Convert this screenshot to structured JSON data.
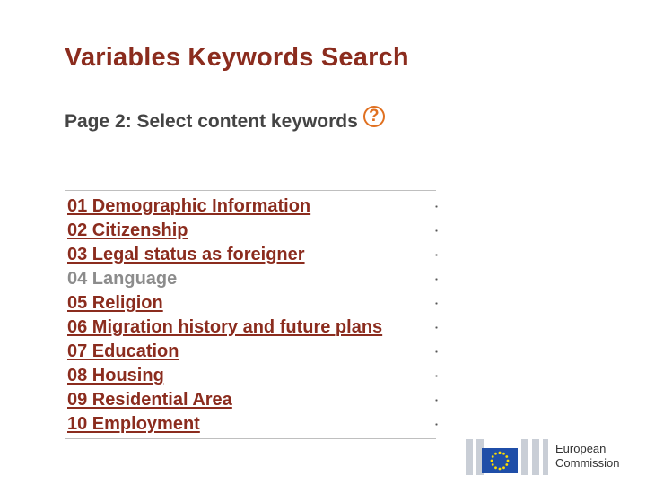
{
  "header": {
    "title": "Variables Keywords Search",
    "subtitle": "Page 2: Select content keywords",
    "help_icon": "help-icon"
  },
  "keywords": [
    {
      "label": "01 Demographic Information",
      "enabled": true
    },
    {
      "label": "02 Citizenship",
      "enabled": true
    },
    {
      "label": "03 Legal status as foreigner",
      "enabled": true
    },
    {
      "label": "04 Language",
      "enabled": false
    },
    {
      "label": "05 Religion",
      "enabled": true
    },
    {
      "label": "06 Migration history and future plans",
      "enabled": true
    },
    {
      "label": "07 Education",
      "enabled": true
    },
    {
      "label": "08 Housing",
      "enabled": true
    },
    {
      "label": "09 Residential Area",
      "enabled": true
    },
    {
      "label": "10 Employment",
      "enabled": true
    }
  ],
  "footer_logo": {
    "line1": "European",
    "line2": "Commission",
    "icon": "eu-flag-icon"
  },
  "colors": {
    "title": "#8b2c1e",
    "link": "#8b2c1e",
    "disabled_link": "#8c8c8c",
    "help_icon": "#e07020",
    "eu_blue": "#1f4ea8",
    "eu_gold": "#ffdd00"
  }
}
